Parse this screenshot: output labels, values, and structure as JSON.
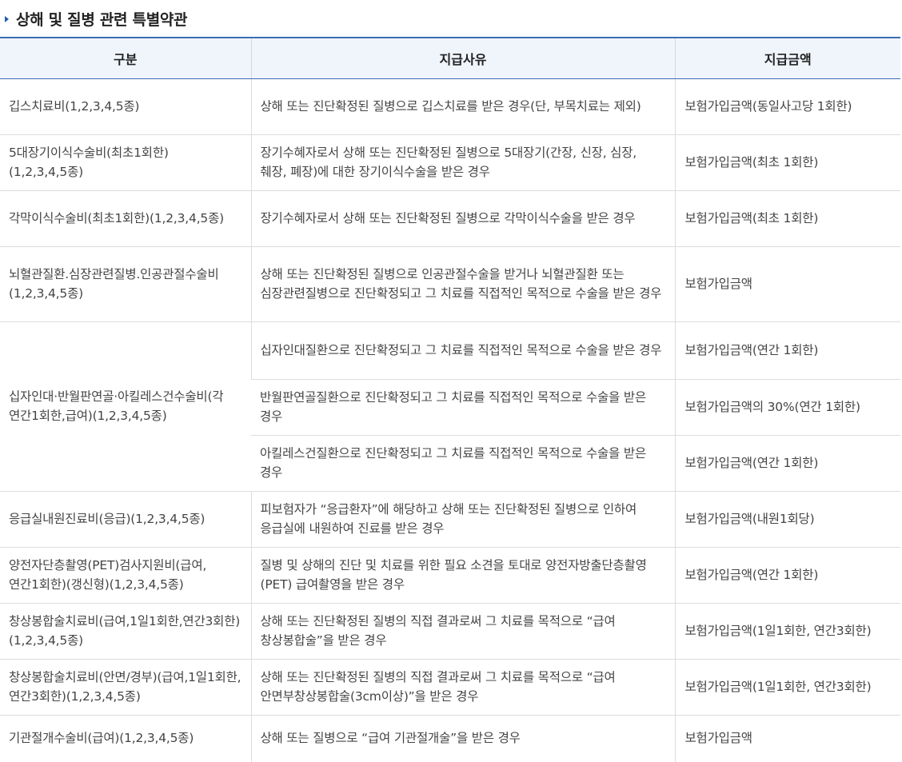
{
  "section": {
    "title": "상해 및 질병 관련 특별약관"
  },
  "table": {
    "headers": [
      "구분",
      "지급사유",
      "지급금액"
    ],
    "rows": [
      {
        "name": "깁스치료비(1,2,3,4,5종)",
        "reason": "상해 또는 진단확정된 질병으로 깁스치료를 받은 경우(단, 부목치료는 제외)",
        "amount": "보험가입금액(동일사고당 1회한)"
      },
      {
        "name": "5대장기이식수술비(최초1회한)(1,2,3,4,5종)",
        "reason": "장기수혜자로서 상해 또는 진단확정된 질병으로 5대장기(간장, 신장, 심장, 췌장, 폐장)에 대한 장기이식수술을 받은 경우",
        "amount": "보험가입금액(최초 1회한)"
      },
      {
        "name": "각막이식수술비(최초1회한)(1,2,3,4,5종)",
        "reason": "장기수혜자로서 상해 또는 진단확정된 질병으로 각막이식수술을 받은 경우",
        "amount": "보험가입금액(최초 1회한)"
      },
      {
        "name": "뇌혈관질환.심장관련질병.인공관절수술비(1,2,3,4,5종)",
        "reason": "상해 또는 진단확정된 질병으로 인공관절수술을 받거나 뇌혈관질환 또는 심장관련질병으로 진단확정되고 그 치료를 직접적인 목적으로 수술을 받은 경우",
        "amount": "보험가입금액"
      },
      {
        "name": "십자인대·반월판연골·아킬레스건수술비(각 연간1회한,급여)(1,2,3,4,5종)",
        "sub": [
          {
            "reason": "십자인대질환으로 진단확정되고 그 치료를 직접적인 목적으로 수술을 받은 경우",
            "amount": "보험가입금액(연간 1회한)"
          },
          {
            "reason": "반월판연골질환으로 진단확정되고 그 치료를 직접적인 목적으로 수술을 받은 경우",
            "amount": "보험가입금액의 30%(연간 1회한)"
          },
          {
            "reason": "아킬레스건질환으로 진단확정되고 그 치료를 직접적인 목적으로 수술을 받은 경우",
            "amount": "보험가입금액(연간 1회한)"
          }
        ]
      },
      {
        "name": "응급실내원진료비(응급)(1,2,3,4,5종)",
        "reason": "피보험자가 “응급환자”에 해당하고 상해 또는 진단확정된 질병으로 인하여 응급실에 내원하여 진료를 받은 경우",
        "amount": "보험가입금액(내원1회당)"
      },
      {
        "name": "양전자단층촬영(PET)검사지원비(급여,연간1회한)(갱신형)(1,2,3,4,5종)",
        "reason": "질병 및 상해의 진단 및 치료를 위한 필요 소견을 토대로 양전자방출단층촬영(PET) 급여촬영을 받은 경우",
        "amount": "보험가입금액(연간 1회한)"
      },
      {
        "name": "창상봉합술치료비(급여,1일1회한,연간3회한)(1,2,3,4,5종)",
        "reason": "상해 또는 진단확정된 질병의 직접 결과로써 그 치료를 목적으로 “급여 창상봉합술”을 받은 경우",
        "amount": "보험가입금액(1일1회한, 연간3회한)"
      },
      {
        "name": "창상봉합술치료비(안면/경부)(급여,1일1회한,연간3회한)(1,2,3,4,5종)",
        "reason": "상해 또는 진단확정된 질병의 직접 결과로써 그 치료를 목적으로 “급여 안면부창상봉합술(3cm이상)”을 받은 경우",
        "amount": "보험가입금액(1일1회한, 연간3회한)"
      },
      {
        "name": "기관절개수술비(급여)(1,2,3,4,5종)",
        "reason": "상해 또는 질병으로 “급여 기관절개술”을 받은 경우",
        "amount": "보험가입금액"
      }
    ]
  },
  "colors": {
    "accent": "#3e6cb5",
    "header_bg": "#f0f5fc",
    "border": "#dddddd"
  }
}
